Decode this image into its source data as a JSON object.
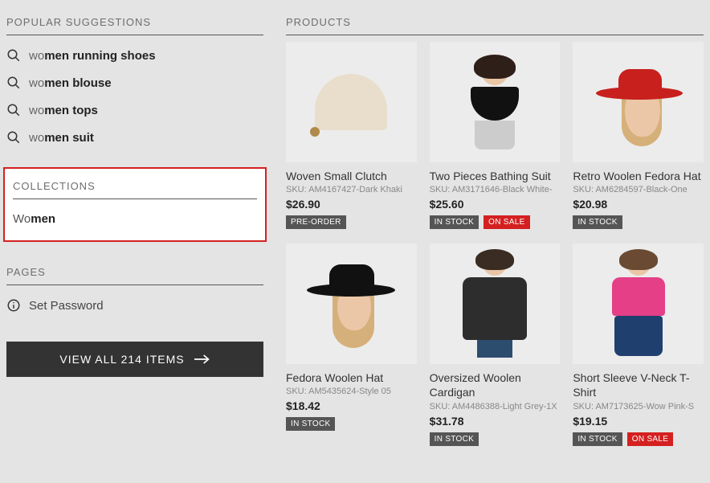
{
  "query_prefix": "wo",
  "sections": {
    "popular_suggestions_title": "POPULAR SUGGESTIONS",
    "collections_title": "COLLECTIONS",
    "pages_title": "PAGES",
    "products_title": "PRODUCTS"
  },
  "suggestions": [
    {
      "prefix": "wo",
      "bold": "men running shoes"
    },
    {
      "prefix": "wo",
      "bold": "men blouse"
    },
    {
      "prefix": "wo",
      "bold": "men tops"
    },
    {
      "prefix": "wo",
      "bold": "men suit"
    }
  ],
  "collections": [
    {
      "prefix": "Wo",
      "bold": "men"
    }
  ],
  "pages": [
    {
      "label": "Set Password"
    }
  ],
  "view_all": {
    "label": "VIEW ALL 214 ITEMS",
    "count": 214
  },
  "badge_labels": {
    "pre_order": "PRE-ORDER",
    "in_stock": "IN STOCK",
    "on_sale": "ON SALE"
  },
  "products": [
    {
      "title": "Woven Small Clutch",
      "sku_full": "SKU: AM4167427-Dark Khaki",
      "price": "$26.90",
      "badges": [
        "pre_order"
      ]
    },
    {
      "title": "Two Pieces Bathing Suit",
      "sku_full": "SKU: AM3171646-Black White-",
      "price": "$25.60",
      "badges": [
        "in_stock",
        "on_sale"
      ]
    },
    {
      "title": "Retro Woolen Fedora Hat",
      "sku_full": "SKU: AM6284597-Black-One",
      "price": "$20.98",
      "badges": [
        "in_stock"
      ]
    },
    {
      "title": "Fedora Woolen Hat",
      "sku_full": "SKU: AM5435624-Style 05",
      "price": "$18.42",
      "badges": [
        "in_stock"
      ]
    },
    {
      "title": "Oversized Woolen Cardigan",
      "sku_full": "SKU: AM4486388-Light Grey-1X",
      "price": "$31.78",
      "badges": [
        "in_stock"
      ]
    },
    {
      "title": "Short Sleeve V-Neck T-Shirt",
      "sku_full": "SKU: AM7173625-Wow Pink-S",
      "price": "$19.15",
      "badges": [
        "in_stock",
        "on_sale"
      ]
    }
  ]
}
